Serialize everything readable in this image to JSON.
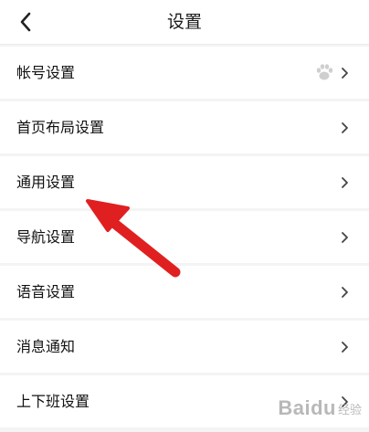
{
  "header": {
    "title": "设置",
    "back_icon": "chevron-left-icon"
  },
  "settings": {
    "items": [
      {
        "label": "帐号设置",
        "icon": "chevron-right-icon",
        "extra_icon": "paw-icon"
      },
      {
        "label": "首页布局设置",
        "icon": "chevron-right-icon"
      },
      {
        "label": "通用设置",
        "icon": "chevron-right-icon"
      },
      {
        "label": "导航设置",
        "icon": "chevron-right-icon"
      },
      {
        "label": "语音设置",
        "icon": "chevron-right-icon"
      },
      {
        "label": "消息通知",
        "icon": "chevron-right-icon"
      },
      {
        "label": "上下班设置",
        "icon": "chevron-right-icon"
      }
    ]
  },
  "annotation": {
    "arrow_color": "#e02020",
    "points_to": "通用设置"
  },
  "watermark": {
    "brand": "Baidu",
    "sub": "经验"
  },
  "colors": {
    "background": "#f4f4f4",
    "row_background": "#ffffff",
    "text": "#111111",
    "chevron": "#444444"
  }
}
